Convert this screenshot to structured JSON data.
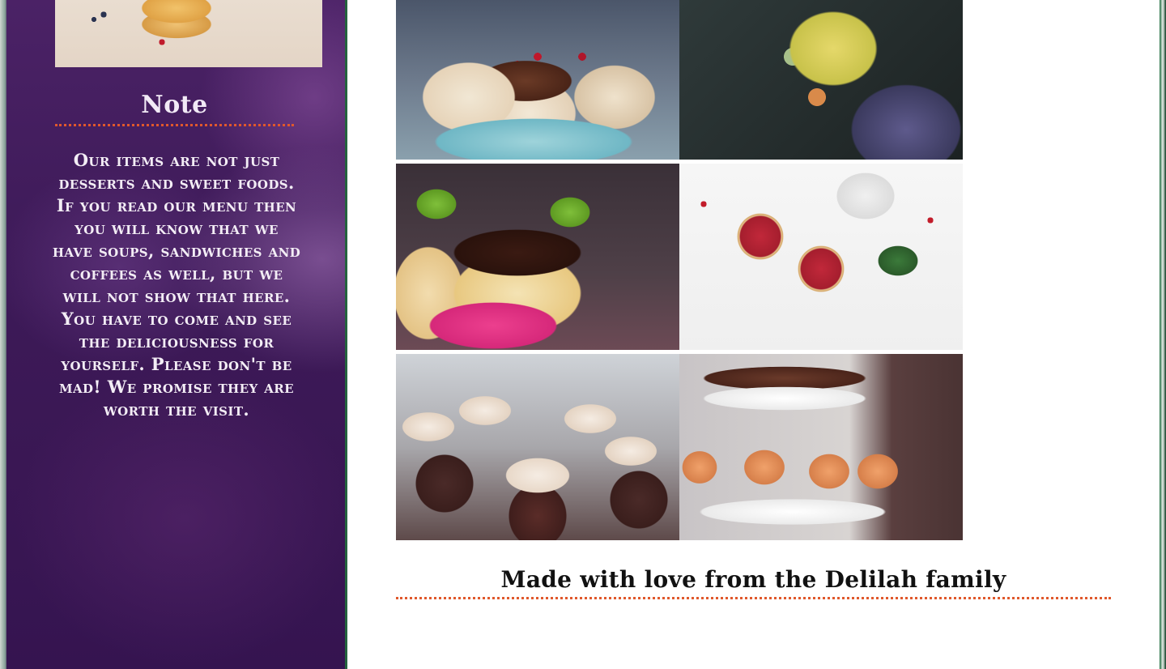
{
  "sidebar": {
    "note_title": "Note",
    "note_text": "Our items are not just desserts and sweet foods. If you read our menu then you will know that we have soups, sandwiches and coffees as well, but we will not show that here. You have to come and see the deliciousness for yourself. Please don't be mad! We promise they are worth the visit."
  },
  "gallery": {
    "photos": [
      {
        "name": "chocolate-drip-cakes-photo"
      },
      {
        "name": "macarons-bowl-photo"
      },
      {
        "name": "kiwi-cheesecake-photo"
      },
      {
        "name": "berry-pies-photo"
      },
      {
        "name": "cupcakes-photo"
      },
      {
        "name": "cake-stand-photo"
      }
    ]
  },
  "footer": {
    "text": "Made with love from the Delilah family"
  },
  "colors": {
    "sidebar_purple": "#3d1a58",
    "accent_dotted": "#e0582c",
    "main_background": "#ffffff"
  }
}
